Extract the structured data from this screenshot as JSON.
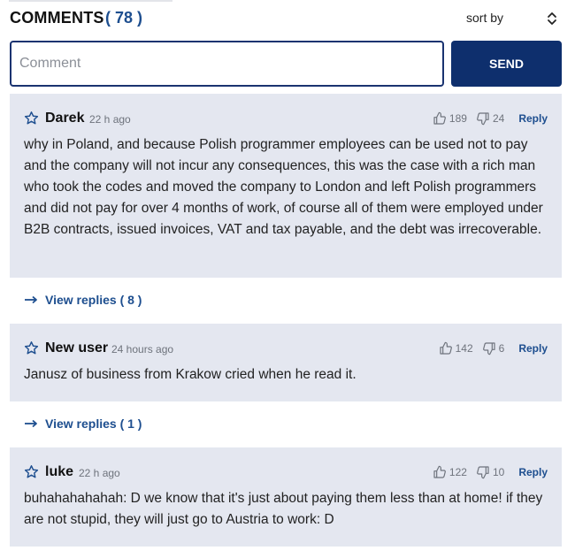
{
  "header": {
    "title": "COMMENTS",
    "count": "( 78 )",
    "sort_label": "sort by",
    "sort_icon": "chevron-up-down-icon"
  },
  "form": {
    "placeholder": "Comment",
    "send_label": "SEND"
  },
  "comments": [
    {
      "author": "Darek",
      "time": "22 h ago",
      "likes": "189",
      "dislikes": "24",
      "reply_label": "Reply",
      "body": "why in Poland, and because Polish programmer employees can be used not to pay and the company will not incur any consequences, this was the case with a rich man who took the codes and moved the company to London and left Polish programmers and did not pay for over 4 months of work, of course all of them were employed under B2B contracts, issued invoices, VAT and tax payable, and the debt was irrecoverable.",
      "view_replies": "View replies ( 8 )"
    },
    {
      "author": "New user",
      "time": "24 hours ago",
      "likes": "142",
      "dislikes": "6",
      "reply_label": "Reply",
      "body": "Janusz of business from Krakow cried when he read it.",
      "view_replies": "View replies ( 1 )"
    },
    {
      "author": "luke",
      "time": "22 h ago",
      "likes": "122",
      "dislikes": "10",
      "reply_label": "Reply",
      "body": "buhahahahahah: D we know that it's just about paying them less than at home! if they are not stupid, they will just go to Austria to work: D"
    }
  ],
  "colors": {
    "accent": "#1d4e8f",
    "button": "#0e2f6d",
    "card": "#e4e7f0"
  }
}
